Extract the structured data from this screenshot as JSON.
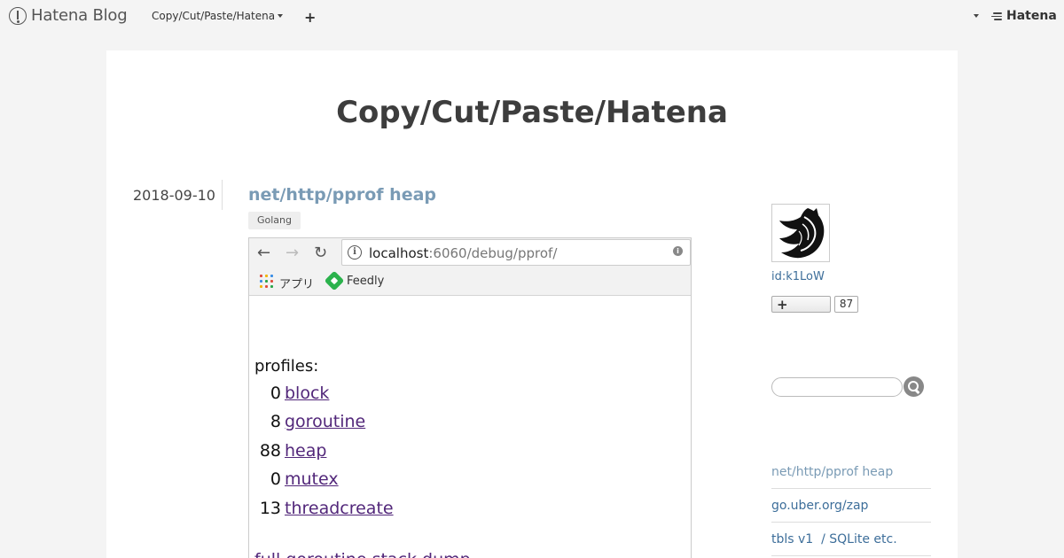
{
  "topbar": {
    "brand": "Hatena Blog",
    "blog_menu": "Copy/Cut/Paste/Hatena",
    "add_symbol": "+",
    "hatena_logo": "Hatena"
  },
  "blog": {
    "title": "Copy/Cut/Paste/Hatena"
  },
  "entry": {
    "date": "2018-09-10",
    "title": "net/http/pprof heap",
    "category": "Golang"
  },
  "screenshot": {
    "url_host": "localhost",
    "url_path": ":6060/debug/pprof/",
    "bookmarks": [
      "アプリ",
      "Feedly"
    ],
    "profiles_heading": "profiles:",
    "profiles": [
      {
        "count": "0",
        "name": "block"
      },
      {
        "count": "8",
        "name": "goroutine"
      },
      {
        "count": "88",
        "name": "heap"
      },
      {
        "count": "0",
        "name": "mutex"
      },
      {
        "count": "13",
        "name": "threadcreate"
      }
    ],
    "full_dump": "full goroutine stack dump"
  },
  "sidebar": {
    "user_id": "id:k1LoW",
    "follow_count": "87",
    "search_placeholder": "",
    "recent": [
      "net/http/pprof heap",
      "go.uber.org/zap",
      "tbls v1  / SQLite etc."
    ]
  },
  "colors": {
    "link": "#3d6e9a",
    "title_link": "#7a9bb5",
    "visited": "#52277a"
  }
}
